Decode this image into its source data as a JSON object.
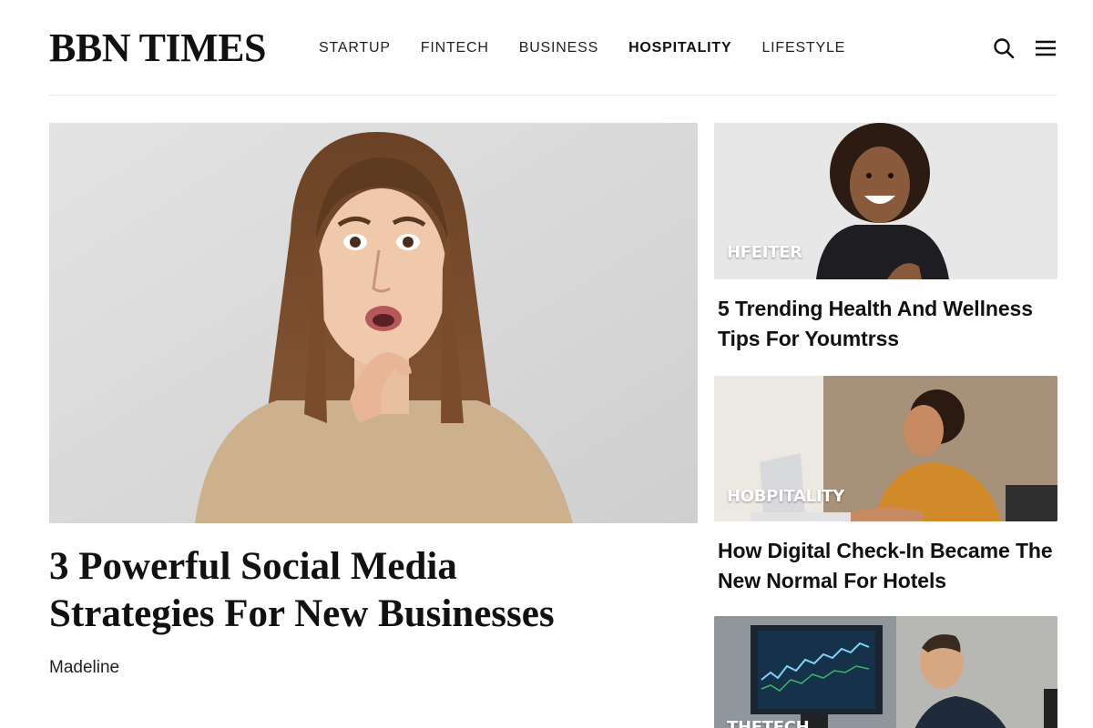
{
  "header": {
    "logo": "BBN TIMES",
    "nav": [
      {
        "label": "STARTUP",
        "active": false
      },
      {
        "label": "FINTECH",
        "active": false
      },
      {
        "label": "BUSINESS",
        "active": false
      },
      {
        "label": "HOSPITALITY",
        "active": true
      },
      {
        "label": "LIFESTYLE",
        "active": false
      }
    ],
    "icons": [
      "search-icon",
      "menu-icon"
    ]
  },
  "featured": {
    "title": "3 Powerful Social Media Strategies For New Businesses",
    "author": "Madeline"
  },
  "side_articles": [
    {
      "tag": "HFEITER",
      "title": "5 Trending Health And Wellness Tips For Youmtrss"
    },
    {
      "tag": "HOBPITALITY",
      "title": "How Digital Check-In Became The New Normal For Hotels"
    },
    {
      "tag": "THETECH",
      "title": ""
    }
  ]
}
